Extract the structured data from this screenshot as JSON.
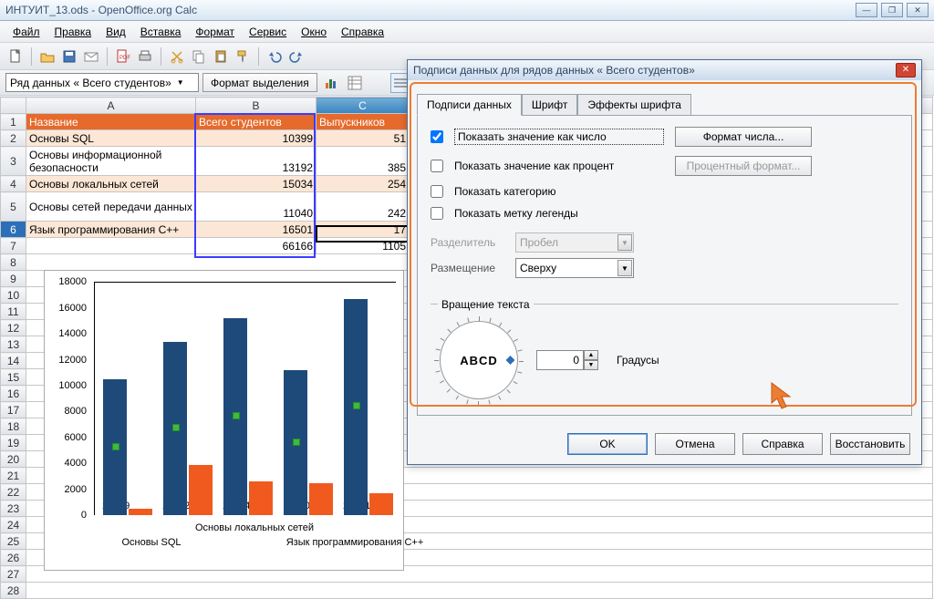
{
  "window": {
    "title": "ИНТУИТ_13.ods - OpenOffice.org Calc"
  },
  "menu": {
    "file": "Файл",
    "edit": "Правка",
    "view": "Вид",
    "insert": "Вставка",
    "format": "Формат",
    "service": "Сервис",
    "window": "Окно",
    "help": "Справка"
  },
  "toolbar2": {
    "combo": "Ряд данных « Всего студентов»",
    "format_sel": "Формат выделения"
  },
  "cols": {
    "a": "A",
    "b": "B",
    "c": "C"
  },
  "headers": {
    "name": "Название",
    "total": "Всего студентов",
    "grad": "Выпускников"
  },
  "rows": [
    {
      "n": "1"
    },
    {
      "n": "2",
      "a": "Основы SQL",
      "b": "10399",
      "c": "51"
    },
    {
      "n": "3",
      "a": "Основы информационной безопасности",
      "b": "13192",
      "c": "385"
    },
    {
      "n": "4",
      "a": "Основы локальных сетей",
      "b": "15034",
      "c": "254"
    },
    {
      "n": "5",
      "a": "Основы сетей передачи данных",
      "b": "11040",
      "c": "242"
    },
    {
      "n": "6",
      "a": "Язык программирования C++",
      "b": "16501",
      "c": "17"
    },
    {
      "n": "7",
      "a": "",
      "b": "66166",
      "c": "1105"
    }
  ],
  "empty_rows": [
    "8",
    "9",
    "10",
    "11",
    "12",
    "13",
    "14",
    "15",
    "16",
    "17",
    "18",
    "19",
    "20",
    "21",
    "22",
    "23",
    "24",
    "25",
    "26",
    "27",
    "28"
  ],
  "chart_data": {
    "type": "bar",
    "categories": [
      "Основы SQL",
      "Основы информационной безопасности",
      "Основы локальных сетей",
      "Основы сетей передачи данных",
      "Язык программирования C++"
    ],
    "xcat_visible": {
      "left": "Основы SQL",
      "mid": "Основы локальных сетей",
      "right": "Язык программирования C++"
    },
    "series": [
      {
        "name": "Всего студентов",
        "values": [
          10399,
          13192,
          15034,
          11040,
          16501
        ]
      },
      {
        "name": "Выпускников",
        "values": [
          513,
          3850,
          2544,
          2427,
          1700
        ]
      }
    ],
    "yticks": [
      "0",
      "2000",
      "4000",
      "6000",
      "8000",
      "10000",
      "12000",
      "14000",
      "16000",
      "18000"
    ],
    "ylim": [
      0,
      18000
    ]
  },
  "dialog": {
    "title": "Подписи данных для рядов данных « Всего студентов»",
    "tabs": {
      "labels": "Подписи данных",
      "font": "Шрифт",
      "effects": "Эффекты шрифта"
    },
    "opts": {
      "as_number": "Показать значение как число",
      "num_format_btn": "Формат числа...",
      "as_percent": "Показать значение как процент",
      "pct_format_btn": "Процентный формат...",
      "show_cat": "Показать категорию",
      "show_legend": "Показать метку легенды"
    },
    "separator_label": "Разделитель",
    "separator_value": "Пробел",
    "placement_label": "Размещение",
    "placement_value": "Сверху",
    "rotation_section": "Вращение текста",
    "rotation_abcd": "ABCD",
    "degrees_value": "0",
    "degrees_label": "Градусы",
    "buttons": {
      "ok": "OK",
      "cancel": "Отмена",
      "help": "Справка",
      "reset": "Восстановить"
    }
  }
}
